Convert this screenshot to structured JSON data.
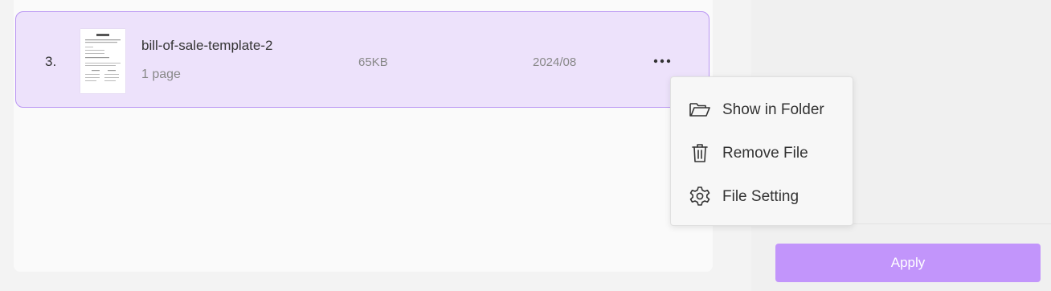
{
  "file_list": {
    "rows": [
      {
        "index": "3.",
        "name": "bill-of-sale-template-2",
        "pages": "1 page",
        "size": "65KB",
        "date": "2024/08",
        "more_icon": "more-horizontal-icon"
      }
    ]
  },
  "context_menu": {
    "items": [
      {
        "label": "Show in Folder",
        "icon": "folder-open-icon"
      },
      {
        "label": "Remove File",
        "icon": "trash-icon"
      },
      {
        "label": "File Setting",
        "icon": "gear-icon"
      }
    ]
  },
  "side_panel": {
    "apply_label": "Apply"
  },
  "colors": {
    "row_selected_bg": "#ede2fb",
    "row_selected_border": "#b995f3",
    "apply_button": "#c295fb"
  }
}
